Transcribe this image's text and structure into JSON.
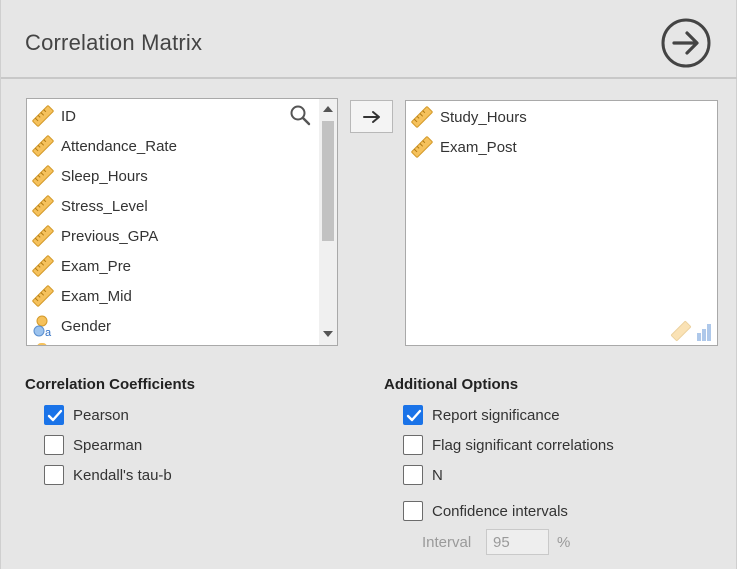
{
  "panel": {
    "title": "Correlation Matrix"
  },
  "source_list": {
    "items": [
      {
        "label": "ID",
        "type": "continuous-ruler-icon"
      },
      {
        "label": "Attendance_Rate",
        "type": "continuous-ruler-icon"
      },
      {
        "label": "Sleep_Hours",
        "type": "continuous-ruler-icon"
      },
      {
        "label": "Stress_Level",
        "type": "continuous-ruler-icon"
      },
      {
        "label": "Previous_GPA",
        "type": "continuous-ruler-icon"
      },
      {
        "label": "Exam_Pre",
        "type": "continuous-ruler-icon"
      },
      {
        "label": "Exam_Mid",
        "type": "continuous-ruler-icon"
      },
      {
        "label": "Gender",
        "type": "nominal-text-icon"
      }
    ]
  },
  "target_list": {
    "items": [
      {
        "label": "Study_Hours",
        "type": "continuous-ruler-icon"
      },
      {
        "label": "Exam_Post",
        "type": "continuous-ruler-icon"
      }
    ]
  },
  "coefficients": {
    "heading": "Correlation Coefficients",
    "pearson": {
      "label": "Pearson",
      "checked": true
    },
    "spearman": {
      "label": "Spearman",
      "checked": false
    },
    "kendall": {
      "label": "Kendall's tau-b",
      "checked": false
    }
  },
  "additional": {
    "heading": "Additional Options",
    "report_significance": {
      "label": "Report significance",
      "checked": true
    },
    "flag_significant": {
      "label": "Flag significant correlations",
      "checked": false
    },
    "n": {
      "label": "N",
      "checked": false
    },
    "confidence_intervals": {
      "label": "Confidence intervals",
      "checked": false
    },
    "interval_label": "Interval",
    "interval_value": "95",
    "interval_unit": "%"
  },
  "colors": {
    "accent": "#1a73e8",
    "ruler": "#f0b94a",
    "background": "#e6e6e6"
  }
}
